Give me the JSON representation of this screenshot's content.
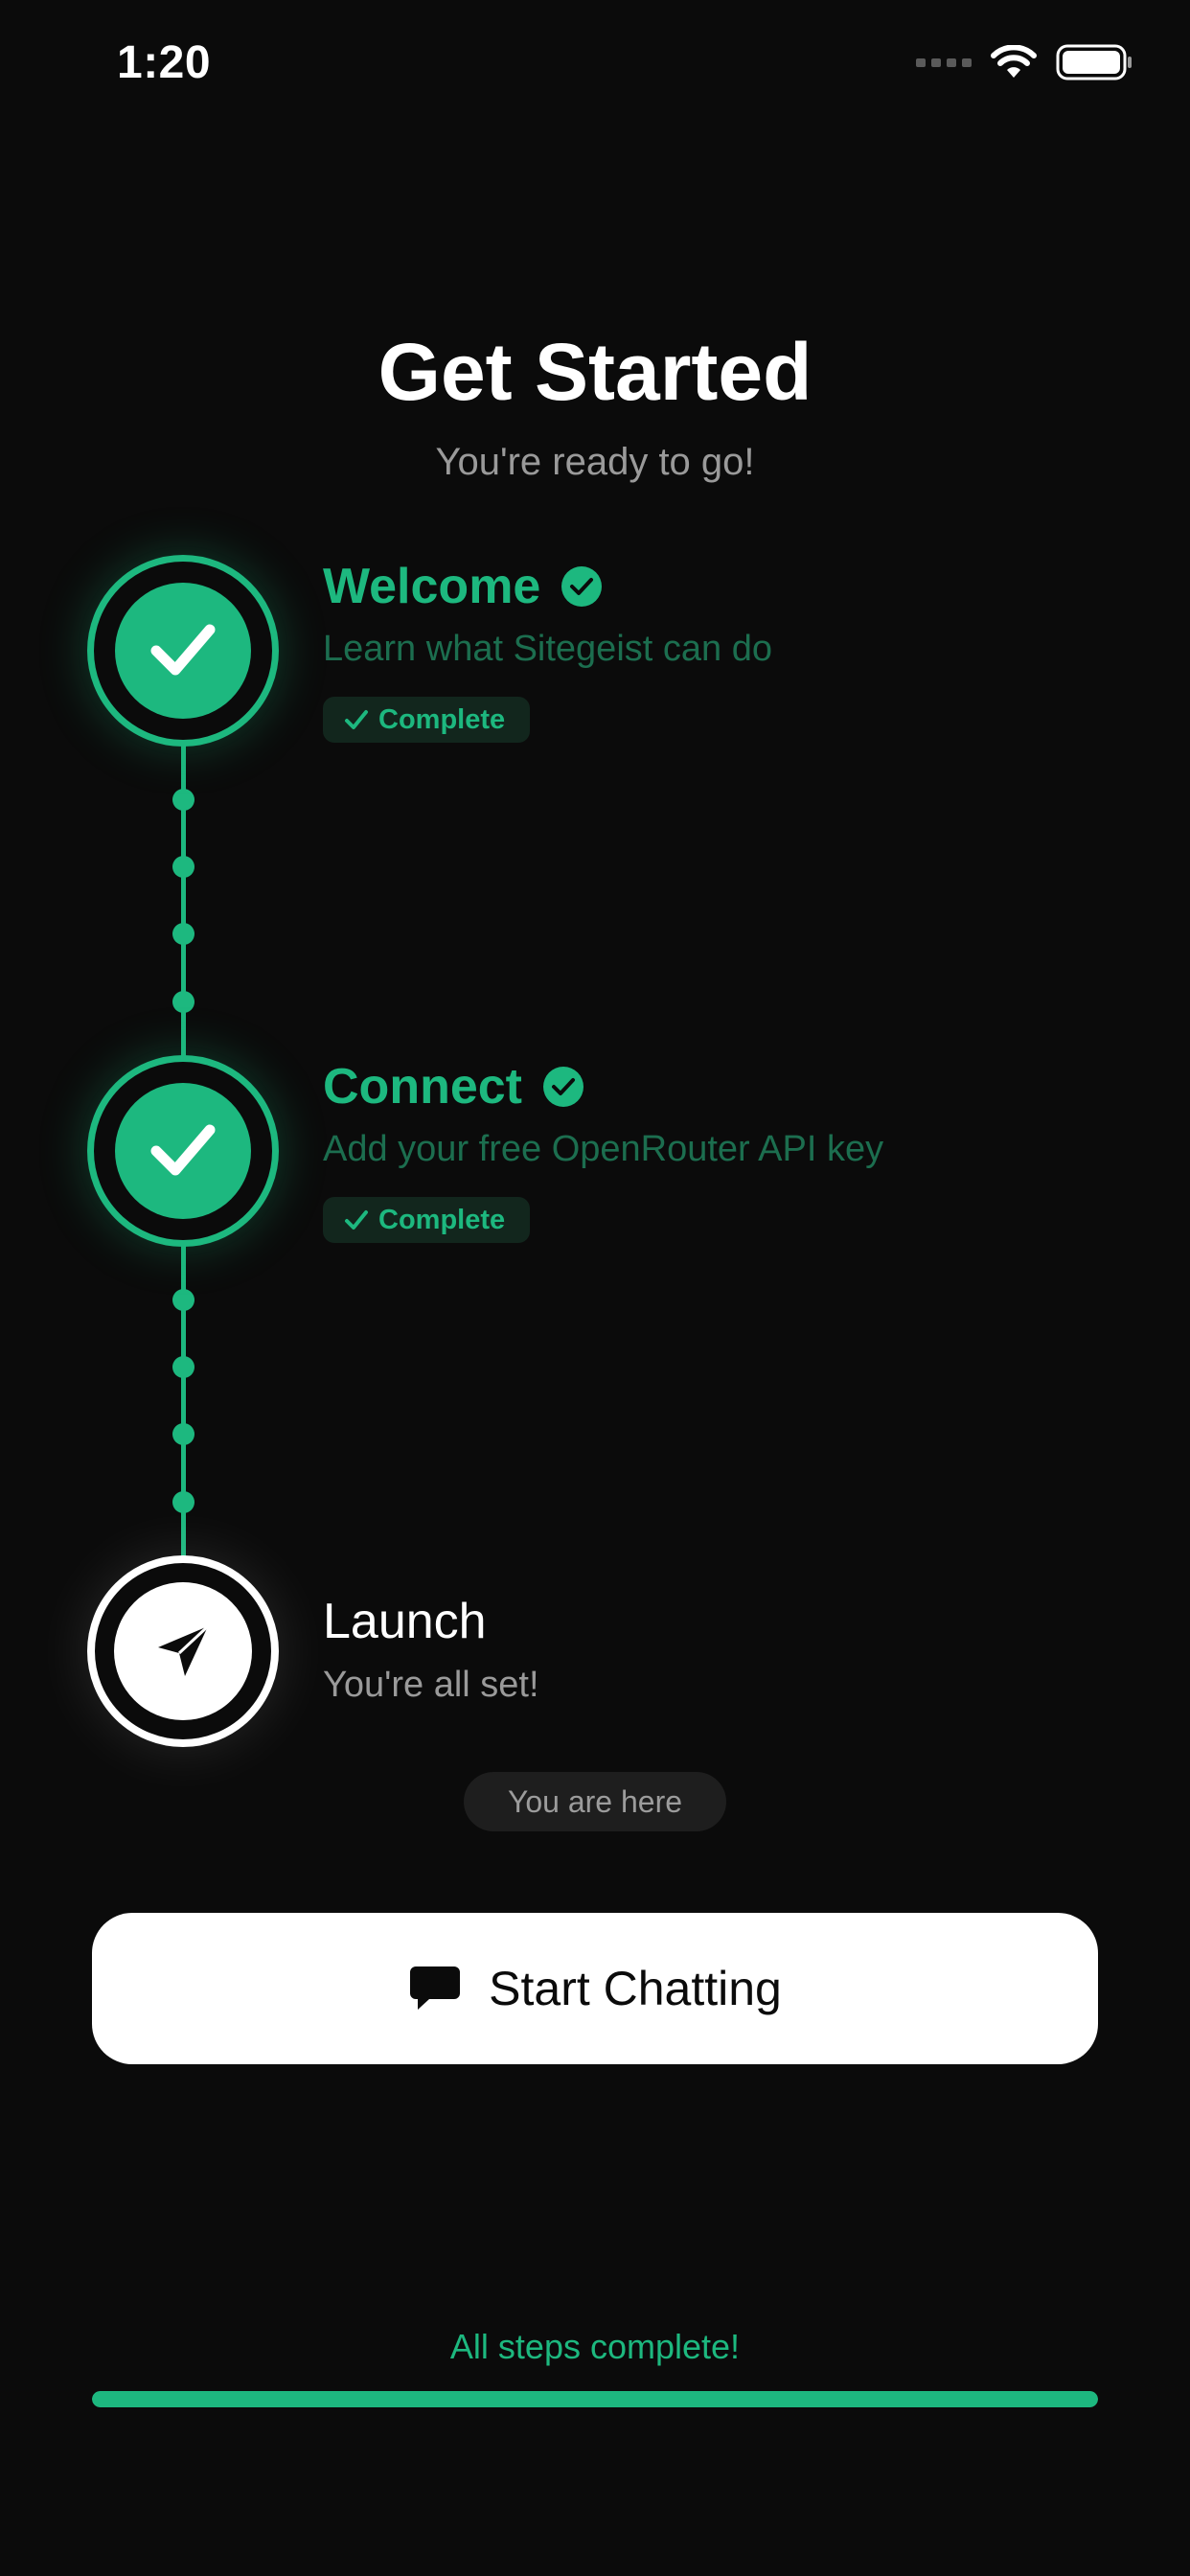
{
  "status_bar": {
    "time": "1:20",
    "icons": [
      "signal-icon",
      "wifi-icon",
      "battery-icon"
    ]
  },
  "header": {
    "title": "Get Started",
    "subtitle": "You're ready to go!"
  },
  "steps": [
    {
      "title": "Welcome",
      "description": "Learn what Sitegeist can do",
      "state": "complete",
      "badge": "Complete",
      "icon": "checkmark-icon"
    },
    {
      "title": "Connect",
      "description": "Add your free OpenRouter API key",
      "state": "complete",
      "badge": "Complete",
      "icon": "checkmark-icon"
    },
    {
      "title": "Launch",
      "description": "You're all set!",
      "state": "current",
      "icon": "paper-plane-icon"
    }
  ],
  "current_marker": "You are here",
  "primary_action": {
    "label": "Start Chatting",
    "icon": "chat-bubble-icon"
  },
  "progress": {
    "label": "All steps complete!",
    "fraction": 1.0
  },
  "colors": {
    "background": "#0b0b0b",
    "accent": "#1db87f",
    "muted_text": "#9a9a9a",
    "button_bg": "#ffffff"
  }
}
